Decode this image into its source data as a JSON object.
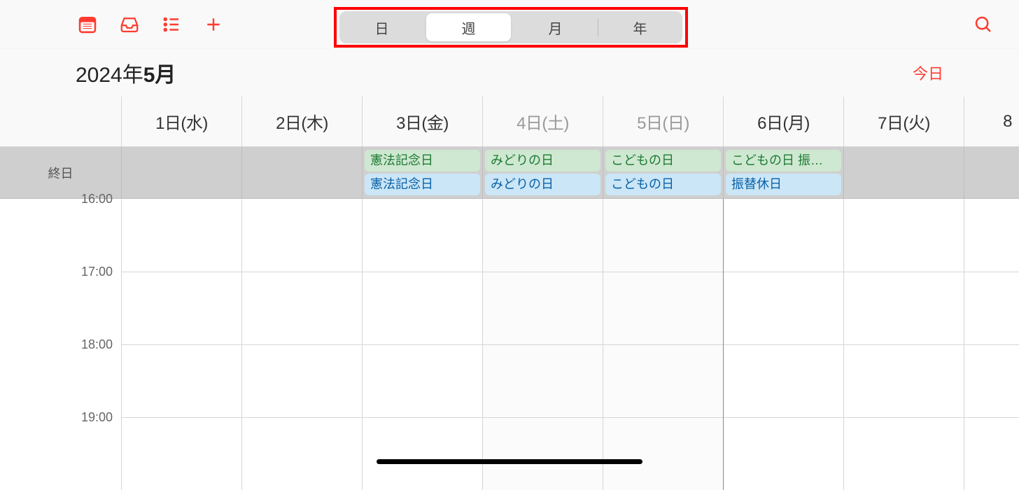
{
  "toolbar": {
    "view_tabs": [
      {
        "label": "日",
        "active": false
      },
      {
        "label": "週",
        "active": true
      },
      {
        "label": "月",
        "active": false
      },
      {
        "label": "年",
        "active": false
      }
    ]
  },
  "title": {
    "year_text": "2024年",
    "month_text": "5月"
  },
  "today_button": "今日",
  "days": [
    {
      "label": "1日(水)",
      "weekend": false
    },
    {
      "label": "2日(木)",
      "weekend": false
    },
    {
      "label": "3日(金)",
      "weekend": false
    },
    {
      "label": "4日(土)",
      "weekend": true
    },
    {
      "label": "5日(日)",
      "weekend": true
    },
    {
      "label": "6日(月)",
      "weekend": false
    },
    {
      "label": "7日(火)",
      "weekend": false
    },
    {
      "label": "8",
      "weekend": false
    }
  ],
  "allday_label": "終日",
  "allday_events": [
    [],
    [],
    [
      {
        "title": "憲法記念日",
        "color": "green"
      },
      {
        "title": "憲法記念日",
        "color": "blue"
      }
    ],
    [
      {
        "title": "みどりの日",
        "color": "green"
      },
      {
        "title": "みどりの日",
        "color": "blue"
      }
    ],
    [
      {
        "title": "こどもの日",
        "color": "green"
      },
      {
        "title": "こどもの日",
        "color": "blue"
      }
    ],
    [
      {
        "title": "こどもの日 振…",
        "color": "green"
      },
      {
        "title": "振替休日",
        "color": "blue"
      }
    ],
    [],
    []
  ],
  "time_labels": [
    "16:00",
    "17:00",
    "18:00",
    "19:00"
  ]
}
